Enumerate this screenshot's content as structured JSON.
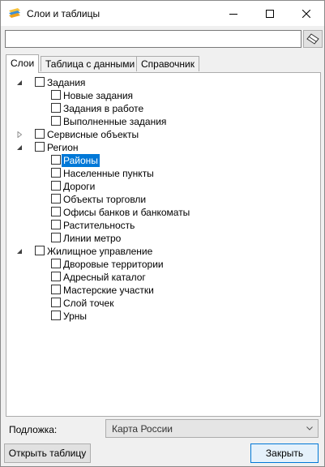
{
  "window": {
    "title": "Слои и таблицы"
  },
  "search": {
    "value": "",
    "placeholder": ""
  },
  "tabs": [
    {
      "label": "Слои",
      "active": true
    },
    {
      "label": "Таблица с данными",
      "active": false
    },
    {
      "label": "Справочник",
      "active": false
    }
  ],
  "tree": [
    {
      "label": "Задания",
      "level": 0,
      "expander": "expanded",
      "checked": false,
      "selected": false
    },
    {
      "label": "Новые задания",
      "level": 1,
      "expander": "none",
      "checked": false,
      "selected": false
    },
    {
      "label": "Задания в работе",
      "level": 1,
      "expander": "none",
      "checked": false,
      "selected": false
    },
    {
      "label": "Выполненные задания",
      "level": 1,
      "expander": "none",
      "checked": false,
      "selected": false
    },
    {
      "label": "Сервисные объекты",
      "level": 0,
      "expander": "collapsed",
      "checked": false,
      "selected": false
    },
    {
      "label": "Регион",
      "level": 0,
      "expander": "expanded",
      "checked": false,
      "selected": false
    },
    {
      "label": "Районы",
      "level": 1,
      "expander": "none",
      "checked": false,
      "selected": true
    },
    {
      "label": "Населенные пункты",
      "level": 1,
      "expander": "none",
      "checked": false,
      "selected": false
    },
    {
      "label": "Дороги",
      "level": 1,
      "expander": "none",
      "checked": false,
      "selected": false
    },
    {
      "label": "Объекты торговли",
      "level": 1,
      "expander": "none",
      "checked": false,
      "selected": false
    },
    {
      "label": "Офисы банков и банкоматы",
      "level": 1,
      "expander": "none",
      "checked": false,
      "selected": false
    },
    {
      "label": "Растительность",
      "level": 1,
      "expander": "none",
      "checked": false,
      "selected": false
    },
    {
      "label": "Линии метро",
      "level": 1,
      "expander": "none",
      "checked": false,
      "selected": false
    },
    {
      "label": "Жилищное управление",
      "level": 0,
      "expander": "expanded",
      "checked": false,
      "selected": false
    },
    {
      "label": "Дворовые территории",
      "level": 1,
      "expander": "none",
      "checked": false,
      "selected": false
    },
    {
      "label": "Адресный каталог",
      "level": 1,
      "expander": "none",
      "checked": false,
      "selected": false
    },
    {
      "label": "Мастерские участки",
      "level": 1,
      "expander": "none",
      "checked": false,
      "selected": false
    },
    {
      "label": "Слой точек",
      "level": 1,
      "expander": "none",
      "checked": false,
      "selected": false
    },
    {
      "label": "Урны",
      "level": 1,
      "expander": "none",
      "checked": false,
      "selected": false
    }
  ],
  "basemap": {
    "label": "Подложка:",
    "selected": "Карта России"
  },
  "buttons": {
    "open_table": "Открыть таблицу",
    "close": "Закрыть"
  },
  "colors": {
    "selection": "#0078d7",
    "primary_border": "#0078d7"
  }
}
